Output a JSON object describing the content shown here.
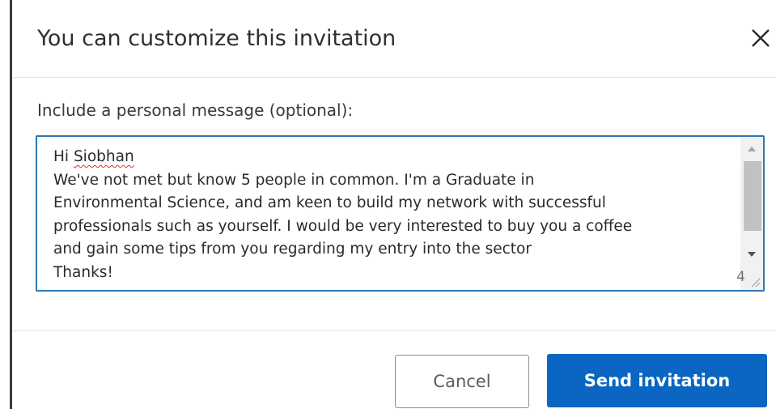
{
  "dialog": {
    "title": "You can customize this invitation",
    "close_label": "×"
  },
  "message": {
    "label": "Include a personal message (optional):",
    "greeting": "Hi ",
    "name": "Siobhan",
    "lines": [
      "We've not met but know 5 people in common. I'm a Graduate in",
      "Environmental Science, and am keen to build my network with successful",
      "professionals such as yourself. I would be very interested to buy you a coffee",
      "and gain some tips from you regarding my entry into the sector",
      "Thanks!"
    ],
    "char_count": "4"
  },
  "actions": {
    "cancel_label": "Cancel",
    "send_label": "Send invitation"
  },
  "colors": {
    "accent": "#0a66c2",
    "focus_border": "#2d77b4"
  },
  "icons": {
    "close": "close-icon",
    "scroll_up": "chevron-up-icon",
    "scroll_down": "chevron-down-icon",
    "resize": "resize-grip-icon"
  }
}
